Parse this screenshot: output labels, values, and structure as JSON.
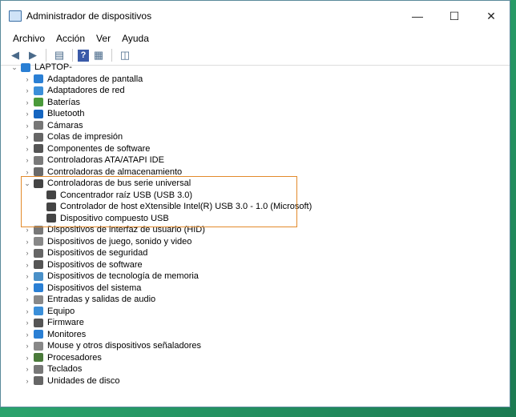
{
  "window": {
    "title": "Administrador de dispositivos"
  },
  "menu": [
    "Archivo",
    "Acción",
    "Ver",
    "Ayuda"
  ],
  "tree": {
    "root": "LAPTOP-",
    "categories": [
      {
        "label": "Adaptadores de pantalla",
        "color": "#2a7fd4"
      },
      {
        "label": "Adaptadores de red",
        "color": "#3b8fd9"
      },
      {
        "label": "Baterías",
        "color": "#4a9a3a"
      },
      {
        "label": "Bluetooth",
        "color": "#1565c0"
      },
      {
        "label": "Cámaras",
        "color": "#777777"
      },
      {
        "label": "Colas de impresión",
        "color": "#666666"
      },
      {
        "label": "Componentes de software",
        "color": "#555555"
      },
      {
        "label": "Controladoras ATA/ATAPI IDE",
        "color": "#7a7a7a"
      },
      {
        "label": "Controladoras de almacenamiento",
        "color": "#6a6a6a"
      },
      {
        "label": "Controladoras de bus serie universal",
        "color": "#444444",
        "expanded": true,
        "children": [
          "Concentrador raíz USB (USB 3.0)",
          "Controlador de host eXtensible Intel(R) USB 3.0 - 1.0 (Microsoft)",
          "Dispositivo compuesto USB"
        ]
      },
      {
        "label": "Dispositivos de interfaz de usuario (HID)",
        "color": "#777777"
      },
      {
        "label": "Dispositivos de juego, sonido y video",
        "color": "#888888"
      },
      {
        "label": "Dispositivos de seguridad",
        "color": "#666666"
      },
      {
        "label": "Dispositivos de software",
        "color": "#555555"
      },
      {
        "label": "Dispositivos de tecnología de memoria",
        "color": "#4a90c8"
      },
      {
        "label": "Dispositivos del sistema",
        "color": "#2a7fd4"
      },
      {
        "label": "Entradas y salidas de audio",
        "color": "#888888"
      },
      {
        "label": "Equipo",
        "color": "#3b8fd9"
      },
      {
        "label": "Firmware",
        "color": "#555555"
      },
      {
        "label": "Monitores",
        "color": "#2a7fd4"
      },
      {
        "label": "Mouse y otros dispositivos señaladores",
        "color": "#888888"
      },
      {
        "label": "Procesadores",
        "color": "#4a7a3a"
      },
      {
        "label": "Teclados",
        "color": "#777777"
      },
      {
        "label": "Unidades de disco",
        "color": "#666666"
      }
    ]
  },
  "highlight_color": "#e38b2b"
}
